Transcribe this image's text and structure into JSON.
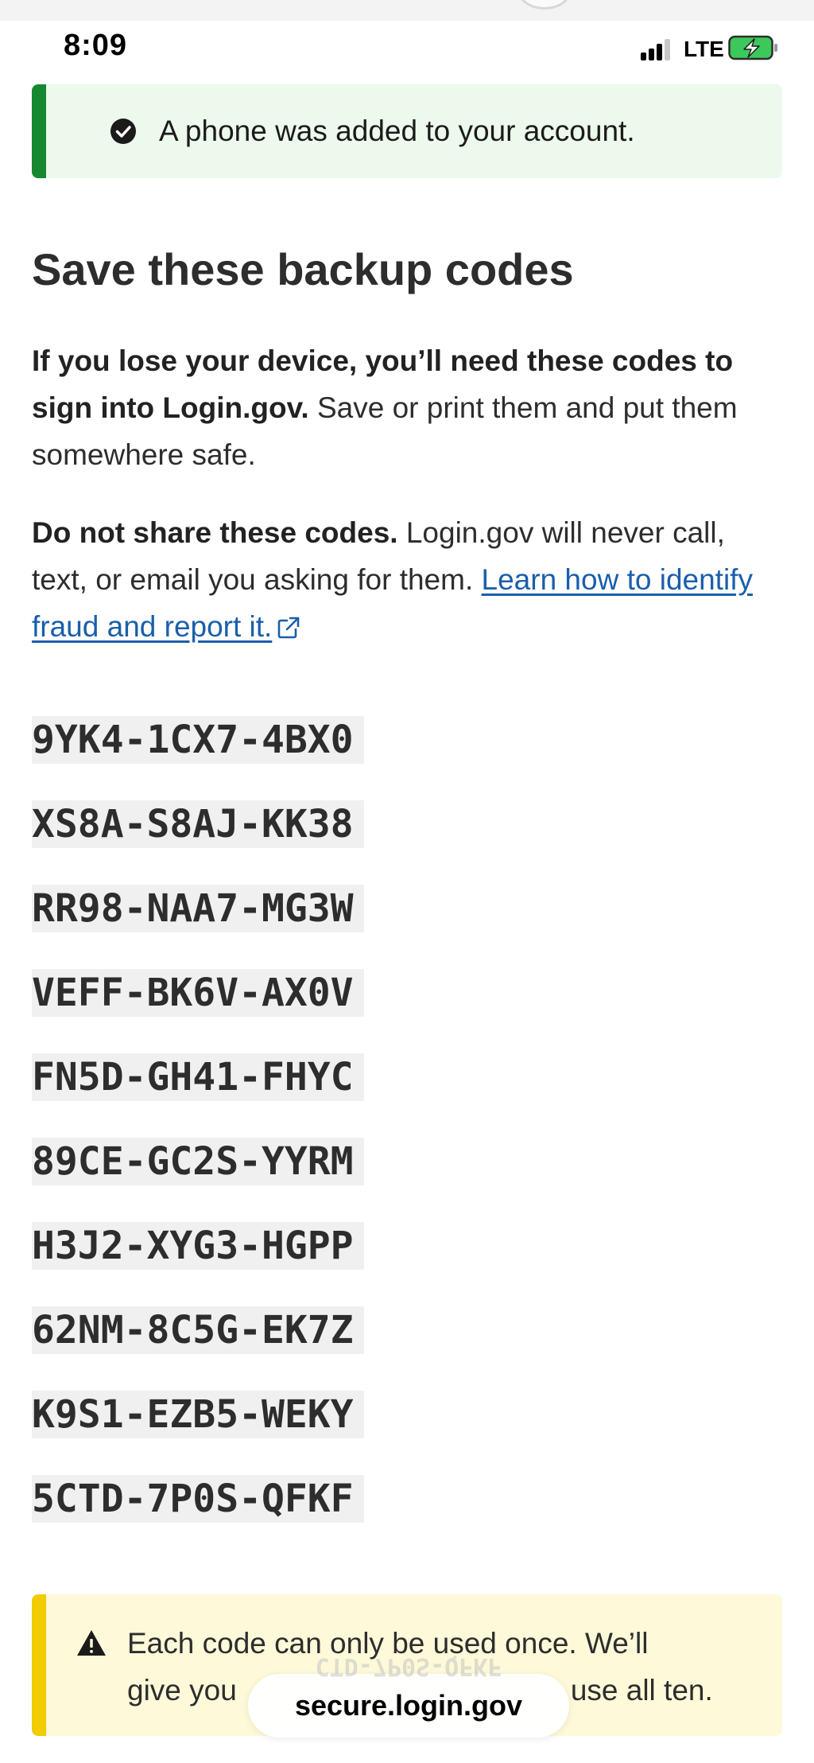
{
  "status_bar": {
    "time": "8:09",
    "network": "LTE",
    "icons": [
      "signal-icon",
      "battery-charging-icon"
    ]
  },
  "success_alert": {
    "message": "A phone was added to your account.",
    "icon": "check-circle-icon",
    "accent_color": "#16882f",
    "background_color": "#ecf9ec"
  },
  "main": {
    "title": "Save these backup codes",
    "paragraph_1": {
      "bold": "If you lose your device, you’ll need these codes to sign into Login.gov.",
      "rest": " Save or print them and put them somewhere safe."
    },
    "paragraph_2": {
      "bold": "Do not share these codes.",
      "rest": " Login.gov will never call, text, or email you asking for them. ",
      "link": "Learn how to identify fraud and report it.",
      "link_icon": "external-link-icon",
      "link_color": "#1a5fab"
    },
    "codes": [
      "9YK4-1CX7-4BX0",
      "XS8A-S8AJ-KK38",
      "RR98-NAA7-MG3W",
      "VEFF-BK6V-AX0V",
      "FN5D-GH41-FHYC",
      "89CE-GC2S-YYRM",
      "H3J2-XYG3-HGPP",
      "62NM-8C5G-EK7Z",
      "K9S1-EZB5-WEKY",
      "5CTD-7P0S-QFKF"
    ]
  },
  "warning_alert": {
    "line_1": "Each code can only be used once. We’ll",
    "line_2_start": "give you",
    "line_2_end": "use all ten.",
    "icon": "warning-triangle-icon",
    "accent_color": "#f0cc00",
    "background_color": "#fdf9d9"
  },
  "browser": {
    "domain": "secure.login.gov",
    "ghost_text": "CTD-7P0S-QFKF"
  }
}
